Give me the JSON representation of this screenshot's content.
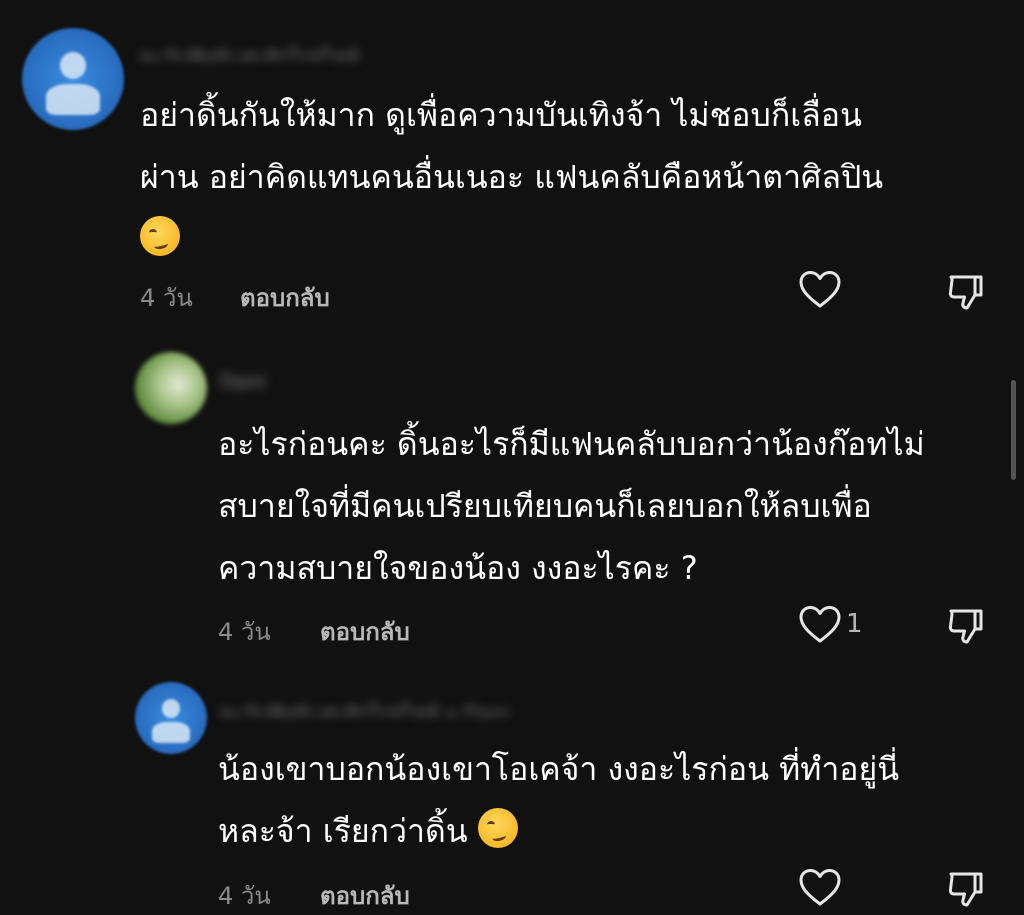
{
  "comments": [
    {
      "username": "ตะวันทิพย์แสนรักโปรไฟล์",
      "text_lines": [
        "อย่าดิ้นกันให้มาก ดูเพื่อความบันเทิงจ้า ไม่ชอบก็เลื่อน",
        "ผ่าน อย่าคิดแทนคนอื่นเนอะ แฟนคลับคือหน้าตาศิลปิน"
      ],
      "emoji": "smirk-emoji",
      "time": "4 วัน",
      "reply_label": "ตอบกลับ",
      "like_count": ""
    },
    {
      "username": "Dani",
      "text_lines": [
        "อะไรก่อนคะ ดิ้นอะไรก็มีแฟนคลับบอกว่าน้องก๊อทไม่",
        "สบายใจที่มีคนเปรียบเทียบคนก็เลยบอกให้ลบเพื่อ",
        "ความสบายใจของน้อง งงอะไรคะ ?"
      ],
      "time": "4 วัน",
      "reply_label": "ตอบกลับ",
      "like_count": "1"
    },
    {
      "username": "ตะวันทิพย์แสนรักโปรไฟล์ • Dani",
      "text_lines": [
        "น้องเขาบอกน้องเขาโอเคจ้า งงอะไรก่อน ที่ทำอยู่นี่",
        "หละจ้า เรียกว่าดิ้น"
      ],
      "emoji": "smirk-emoji",
      "time": "4 วัน",
      "reply_label": "ตอบกลับ",
      "like_count": ""
    }
  ]
}
